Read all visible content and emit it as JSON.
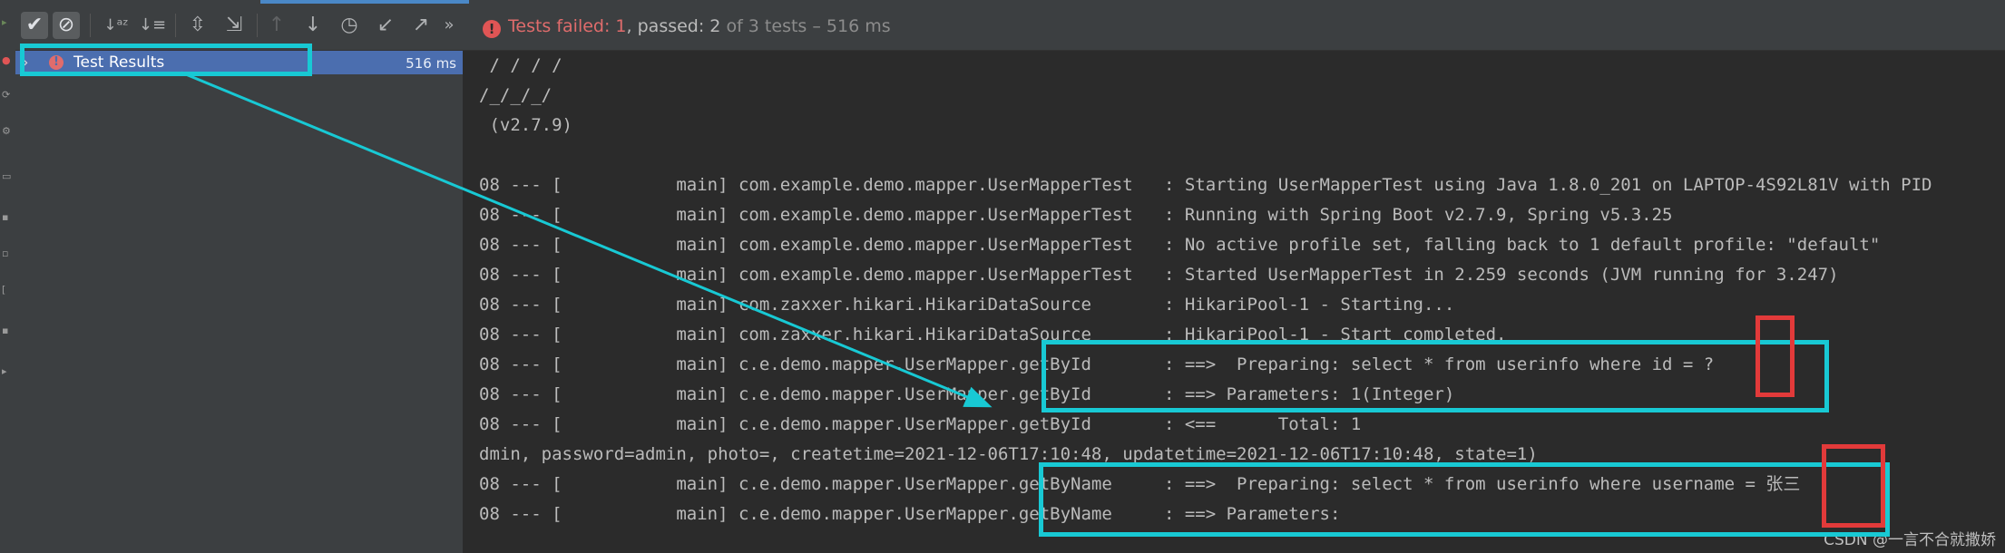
{
  "toolbar": {
    "buttons": [
      {
        "name": "show-passed",
        "icon": "✔",
        "active": true
      },
      {
        "name": "show-ignored",
        "icon": "⊘",
        "active": true
      },
      {
        "name": "sort-alpha",
        "icon": "↓ᵃᶻ"
      },
      {
        "name": "sort-duration",
        "icon": "↓≡"
      },
      {
        "name": "expand-all",
        "icon": "⇳"
      },
      {
        "name": "collapse-all",
        "icon": "⇲"
      },
      {
        "name": "prev-failed",
        "icon": "↑",
        "disabled": true
      },
      {
        "name": "next-failed",
        "icon": "↓"
      },
      {
        "name": "history",
        "icon": "◷"
      },
      {
        "name": "import",
        "icon": "↙"
      },
      {
        "name": "export",
        "icon": "↗"
      }
    ],
    "more": "»"
  },
  "status": {
    "failed": "Tests failed: 1",
    "passed": ", passed: 2",
    "rest": " of 3 tests – 516 ms"
  },
  "tree": {
    "root_label": "Test Results",
    "root_duration": "516 ms"
  },
  "console": {
    "lines": [
      " / / / /",
      "/_/_/_/",
      " (v2.7.9)",
      "",
      "08 --- [           main] com.example.demo.mapper.UserMapperTest   : Starting UserMapperTest using Java 1.8.0_201 on LAPTOP-4S92L81V with PID",
      "08 --- [           main] com.example.demo.mapper.UserMapperTest   : Running with Spring Boot v2.7.9, Spring v5.3.25",
      "08 --- [           main] com.example.demo.mapper.UserMapperTest   : No active profile set, falling back to 1 default profile: \"default\"",
      "08 --- [           main] com.example.demo.mapper.UserMapperTest   : Started UserMapperTest in 2.259 seconds (JVM running for 3.247)",
      "08 --- [           main] com.zaxxer.hikari.HikariDataSource       : HikariPool-1 - Starting...",
      "08 --- [           main] com.zaxxer.hikari.HikariDataSource       : HikariPool-1 - Start completed.",
      "08 --- [           main] c.e.demo.mapper.UserMapper.getById       : ==>  Preparing: select * from userinfo where id = ?",
      "08 --- [           main] c.e.demo.mapper.UserMapper.getById       : ==> Parameters: 1(Integer)",
      "08 --- [           main] c.e.demo.mapper.UserMapper.getById       : <==      Total: 1",
      "dmin, password=admin, photo=, createtime=2021-12-06T17:10:48, updatetime=2021-12-06T17:10:48, state=1)",
      "08 --- [           main] c.e.demo.mapper.UserMapper.getByName     : ==>  Preparing: select * from userinfo where username = 张三",
      "08 --- [           main] c.e.demo.mapper.UserMapper.getByName     : ==> Parameters:"
    ]
  },
  "watermark": "CSDN @一言不合就撒娇",
  "colors": {
    "annotation_cyan": "#18c9d4",
    "annotation_red": "#e23a3a",
    "selection": "#4b6eaf",
    "fail": "#e06c6c"
  }
}
